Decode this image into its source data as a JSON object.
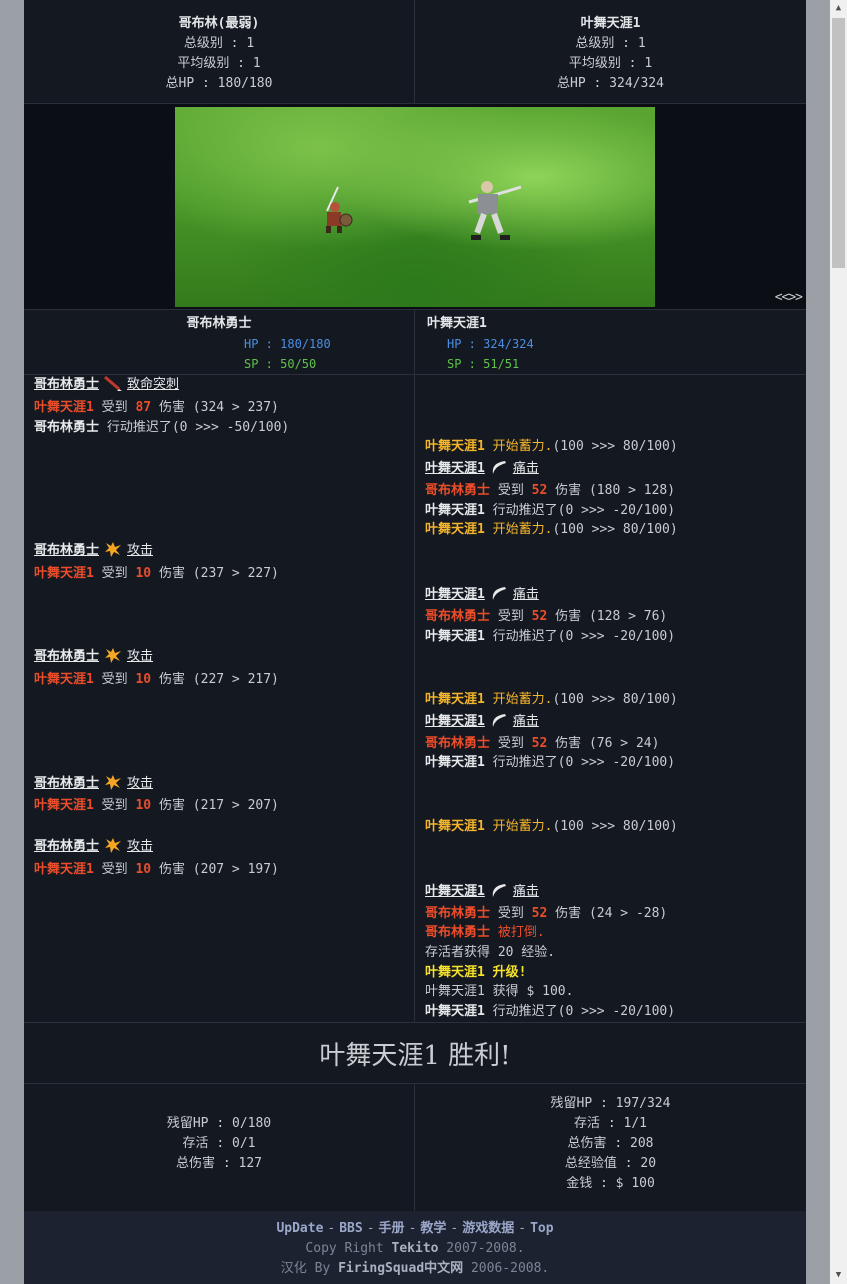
{
  "summary": {
    "left": {
      "name": "哥布林(最弱)",
      "total_level": "总级别 : 1",
      "avg_level": "平均级别 : 1",
      "total_hp": "总HP : 180/180"
    },
    "right": {
      "name": "叶舞天涯1",
      "total_level": "总级别 : 1",
      "avg_level": "平均级别 : 1",
      "total_hp": "总HP : 324/324"
    }
  },
  "scene": {
    "nav": "<<>>"
  },
  "status": {
    "left": {
      "name": "哥布林勇士",
      "hp": "HP : 180/180",
      "sp": "SP : 50/50"
    },
    "right": {
      "name": "叶舞天涯1",
      "hp": "HP : 324/324",
      "sp": "SP : 51/51"
    }
  },
  "log": {
    "l1_who": "哥布林勇士",
    "l1_skill": "致命突刺",
    "l2_a": "叶舞天涯1",
    "l2_b": " 受到 ",
    "l2_c": "87",
    "l2_d": " 伤害 (324 > 237)",
    "l3_a": "哥布林勇士",
    "l3_b": " 行动推迟了(0 >>> -50/100)",
    "r1_a": "叶舞天涯1",
    "r1_b": " 开始蓄力.",
    "r1_c": "(100 >>> 80/100)",
    "r2_who": "叶舞天涯1",
    "r2_skill": "痛击",
    "r3_a": "哥布林勇士",
    "r3_b": " 受到 ",
    "r3_c": "52",
    "r3_d": " 伤害 (180 > 128)",
    "r4_a": "叶舞天涯1",
    "r4_b": " 行动推迟了(0 >>> -20/100)",
    "r5_a": "叶舞天涯1",
    "r5_b": " 开始蓄力.",
    "r5_c": "(100 >>> 80/100)",
    "l4_who": "哥布林勇士",
    "l4_skill": "攻击",
    "l5_a": "叶舞天涯1",
    "l5_b": " 受到 ",
    "l5_c": "10",
    "l5_d": " 伤害 (237 > 227)",
    "r6_who": "叶舞天涯1",
    "r6_skill": "痛击",
    "r7_a": "哥布林勇士",
    "r7_b": " 受到 ",
    "r7_c": "52",
    "r7_d": " 伤害 (128 > 76)",
    "r8_a": "叶舞天涯1",
    "r8_b": " 行动推迟了(0 >>> -20/100)",
    "l6_who": "哥布林勇士",
    "l6_skill": "攻击",
    "l7_a": "叶舞天涯1",
    "l7_b": " 受到 ",
    "l7_c": "10",
    "l7_d": " 伤害 (227 > 217)",
    "r9_a": "叶舞天涯1",
    "r9_b": " 开始蓄力.",
    "r9_c": "(100 >>> 80/100)",
    "r10_who": "叶舞天涯1",
    "r10_skill": "痛击",
    "r11_a": "哥布林勇士",
    "r11_b": " 受到 ",
    "r11_c": "52",
    "r11_d": " 伤害 (76 > 24)",
    "r12_a": "叶舞天涯1",
    "r12_b": " 行动推迟了(0 >>> -20/100)",
    "l8_who": "哥布林勇士",
    "l8_skill": "攻击",
    "l9_a": "叶舞天涯1",
    "l9_b": " 受到 ",
    "l9_c": "10",
    "l9_d": " 伤害 (217 > 207)",
    "r13_a": "叶舞天涯1",
    "r13_b": " 开始蓄力.",
    "r13_c": "(100 >>> 80/100)",
    "l10_who": "哥布林勇士",
    "l10_skill": "攻击",
    "l11_a": "叶舞天涯1",
    "l11_b": " 受到 ",
    "l11_c": "10",
    "l11_d": " 伤害 (207 > 197)",
    "r14_who": "叶舞天涯1",
    "r14_skill": "痛击",
    "r15_a": "哥布林勇士",
    "r15_b": " 受到 ",
    "r15_c": "52",
    "r15_d": " 伤害 (24 > -28)",
    "r16_a": "哥布林勇士",
    "r16_b": " 被打倒.",
    "r17": "存活者获得 20 经验.",
    "r18": "叶舞天涯1 升级!",
    "r19": "叶舞天涯1 获得 $  100.",
    "r20_a": "叶舞天涯1",
    "r20_b": " 行动推迟了(0 >>> -20/100)"
  },
  "victory": "叶舞天涯1 胜利!",
  "final": {
    "left": {
      "hp": "残留HP : 0/180",
      "alive": "存活 : 0/1",
      "damage": "总伤害 : 127"
    },
    "right": {
      "hp": "残留HP : 197/324",
      "alive": "存活 : 1/1",
      "damage": "总伤害 : 208",
      "exp": "总经验值 : 20",
      "money": "金钱 : $  100"
    }
  },
  "footer": {
    "links": [
      "UpDate",
      "BBS",
      "手册",
      "教学",
      "游戏数据",
      "Top"
    ],
    "sep": "-",
    "copy1_a": "Copy Right ",
    "copy1_b": "Tekito",
    "copy1_c": " 2007-2008.",
    "copy2_a": "汉化 By ",
    "copy2_b": "FiringSquad中文网",
    "copy2_c": " 2006-2008."
  },
  "colors": {
    "damage": "#ea4d2a",
    "charge": "#f5b52a",
    "levelup": "#f5e22a",
    "hp": "#4b8fe3",
    "sp": "#5fc24a"
  }
}
